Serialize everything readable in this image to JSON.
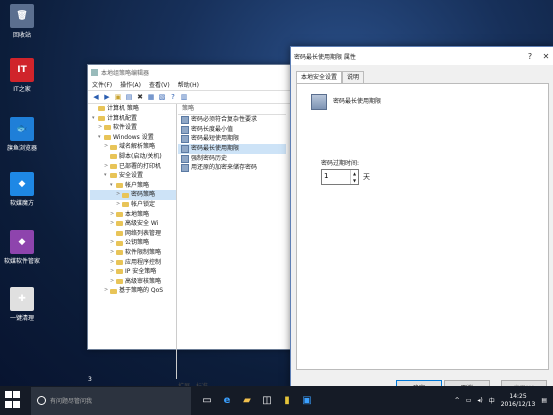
{
  "desktop": {
    "icons": [
      {
        "label": "回收站",
        "glyph": "🗑",
        "color": "#5b6f8f"
      },
      {
        "label": "IT之家",
        "glyph": "IT",
        "color": "#d0242b"
      },
      {
        "label": "旗鱼浏览器",
        "glyph": "🐟",
        "color": "#1f7fd8"
      },
      {
        "label": "软媒魔方",
        "glyph": "◆",
        "color": "#1e88e5"
      },
      {
        "label": "软媒软件管家",
        "glyph": "◆",
        "color": "#8e44ad"
      },
      {
        "label": "一键清理",
        "glyph": "✚",
        "color": "#e0e0e0"
      }
    ],
    "page_num": "3"
  },
  "gpedit": {
    "title": "本地组策略编辑器",
    "menu": [
      "文件(F)",
      "操作(A)",
      "查看(V)",
      "帮助(H)"
    ],
    "tree": [
      {
        "level": 0,
        "exp": "",
        "text": "计算机 策略"
      },
      {
        "level": 0,
        "exp": "▾",
        "text": "计算机配置"
      },
      {
        "level": 1,
        "exp": ">",
        "text": "软件设置"
      },
      {
        "level": 1,
        "exp": "▾",
        "text": "Windows 设置"
      },
      {
        "level": 2,
        "exp": ">",
        "text": "域名解析策略"
      },
      {
        "level": 2,
        "exp": "",
        "text": "脚本(启动/关机)"
      },
      {
        "level": 2,
        "exp": ">",
        "text": "已部署的打印机"
      },
      {
        "level": 2,
        "exp": "▾",
        "text": "安全设置"
      },
      {
        "level": 3,
        "exp": "▾",
        "text": "帐户策略"
      },
      {
        "level": 4,
        "exp": ">",
        "text": "密码策略"
      },
      {
        "level": 4,
        "exp": ">",
        "text": "帐户锁定"
      },
      {
        "level": 3,
        "exp": ">",
        "text": "本地策略"
      },
      {
        "level": 3,
        "exp": ">",
        "text": "高级安全 Wi"
      },
      {
        "level": 3,
        "exp": "",
        "text": "网络列表管理"
      },
      {
        "level": 3,
        "exp": ">",
        "text": "公钥策略"
      },
      {
        "level": 3,
        "exp": ">",
        "text": "软件限制策略"
      },
      {
        "level": 3,
        "exp": ">",
        "text": "应用程序控制"
      },
      {
        "level": 3,
        "exp": ">",
        "text": "IP 安全策略"
      },
      {
        "level": 3,
        "exp": ">",
        "text": "高级审核策略"
      },
      {
        "level": 2,
        "exp": ">",
        "text": "基于策略的 QoS"
      }
    ],
    "list_header": "策略",
    "policies": [
      "密码必须符合复杂性要求",
      "密码长度最小值",
      "密码最短使用期限",
      "密码最长使用期限",
      "强制密码历史",
      "用还原的加密来储存密码"
    ],
    "tabs": [
      "扩展",
      "标准"
    ]
  },
  "dialog": {
    "title": "密码最长使用期限 属性",
    "tabs": [
      "本地安全设置",
      "说明"
    ],
    "policy_name": "密码最长使用期限",
    "field_label": "密码过期时间:",
    "value": "1",
    "unit": "天",
    "ok": "确定",
    "cancel": "取消",
    "apply": "应用(A)"
  },
  "taskbar": {
    "search_placeholder": "有问题尽管问我",
    "lang": "中",
    "time": "14:25",
    "date": "2016/12/13"
  }
}
